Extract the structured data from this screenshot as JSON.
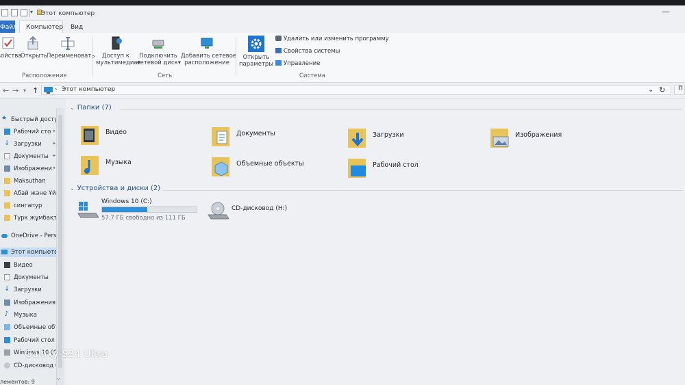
{
  "window": {
    "title": "Этот компьютер",
    "tabs": [
      "Файл",
      "Компьютер",
      "Вид"
    ]
  },
  "ribbon": {
    "properties_label": "войства",
    "open_label": "Открыть",
    "rename_label": "Переименовать",
    "media_label_1": "Доступ к",
    "media_label_2": "мультимедиа",
    "map_drive_label_1": "Подключить",
    "map_drive_label_2": "сетевой диск",
    "add_location_label_1": "Добавить сетевое",
    "add_location_label_2": "расположение",
    "open_settings_label_1": "Открыть",
    "open_settings_label_2": "параметры",
    "uninstall_label": "Удалить или изменить программу",
    "system_props_label": "Свойства системы",
    "manage_label": "Управление",
    "group_location": "Расположение",
    "group_network": "Сеть",
    "group_system": "Система"
  },
  "address": {
    "path": "Этот компьютер",
    "search_fragment": "П"
  },
  "nav": {
    "quick_access": "Быстрый доступ",
    "quick_items": [
      "Рабочий сто",
      "Загрузки",
      "Документы",
      "Изображени",
      "Maksuthan",
      "Абай және Ұйғы",
      "сингапур",
      "Түрк жұмбақта"
    ],
    "onedrive": "OneDrive - Persor",
    "this_pc": "Этот компьютер",
    "pc_items": [
      "Видео",
      "Документы",
      "Загрузки",
      "Изображения",
      "Музыка",
      "Объемные объ",
      "Рабочий стол",
      "Windows 10 (C:)",
      "CD-дисковод (H"
    ],
    "status": "лементов: 9"
  },
  "content": {
    "folders_header": "Папки (7)",
    "folders": [
      "Видео",
      "Документы",
      "Загрузки",
      "Изображения",
      "Музыка",
      "Объемные объекты",
      "Рабочий стол"
    ],
    "devices_header": "Устройства и диски (2)",
    "drive_c": {
      "name": "Windows 10 (C:)",
      "free": "57,7 ГБ свободно из 111 ГБ",
      "used_fraction": 0.48
    },
    "drive_h": {
      "name": "CD-дисковод (H:)"
    }
  },
  "watermark": "Galaxy S24 Ultra",
  "colors": {
    "accent": "#2e73c8",
    "drive_fill": "#2f8ed8",
    "folder": "#e7c35a"
  }
}
